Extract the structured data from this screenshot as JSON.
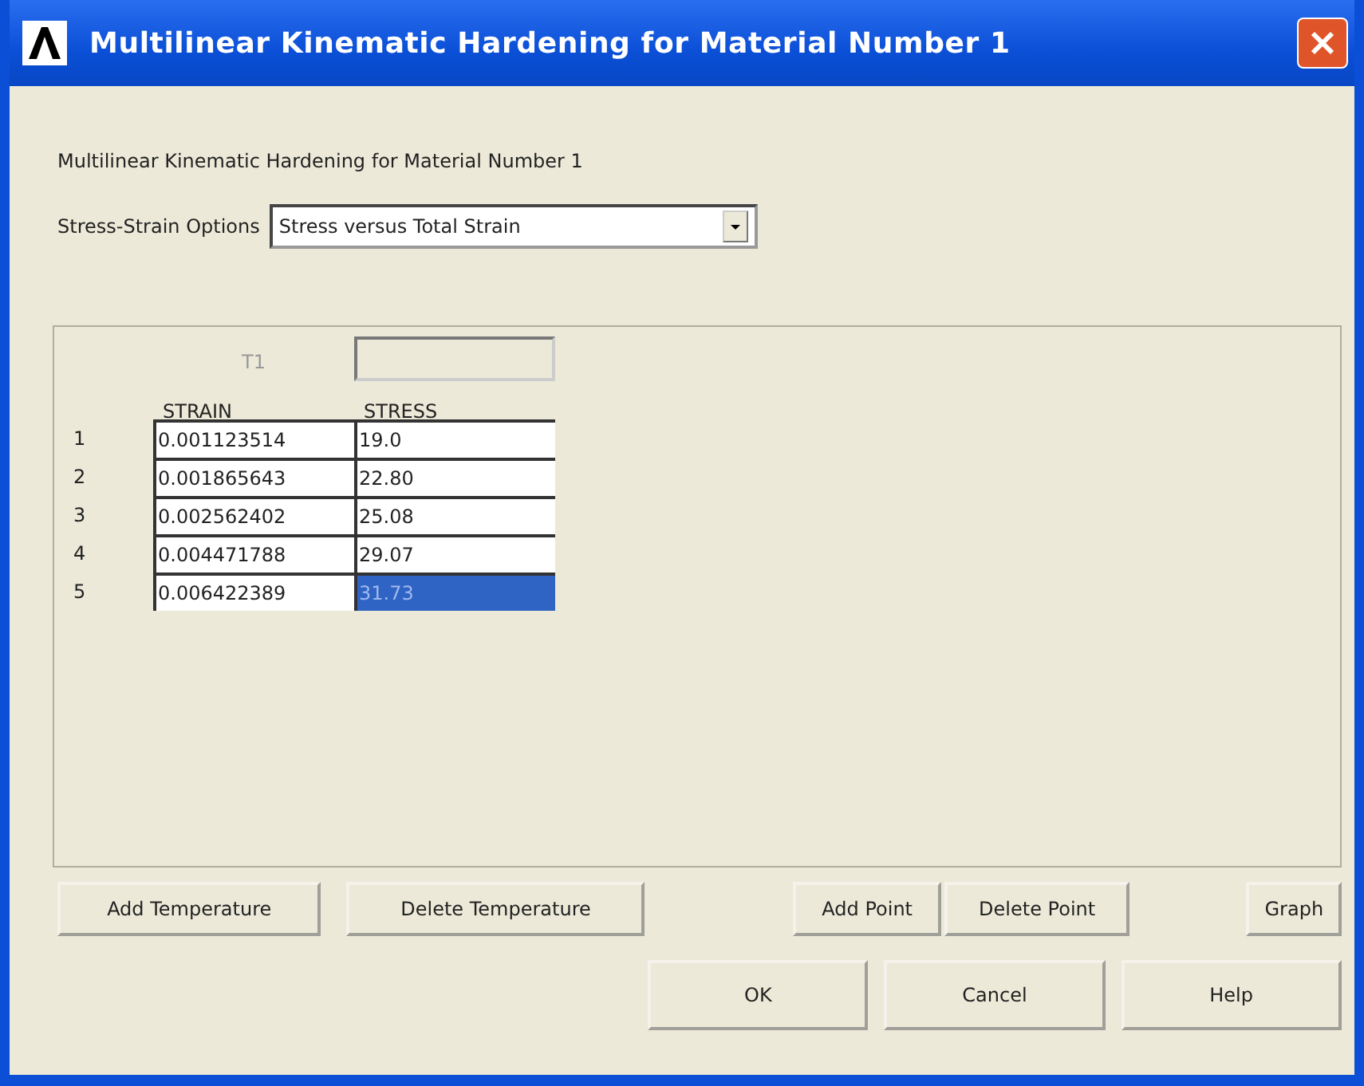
{
  "window": {
    "title": "Multilinear Kinematic Hardening for Material Number 1"
  },
  "heading": "Multilinear Kinematic Hardening for Material Number 1",
  "options": {
    "label": "Stress-Strain Options",
    "value": "Stress versus Total Strain"
  },
  "table": {
    "temperature_label": "T1",
    "columns": [
      "STRAIN",
      "STRESS"
    ],
    "rows": [
      {
        "number": "1",
        "strain": "0.001123514",
        "stress": "19.0",
        "selected": false
      },
      {
        "number": "2",
        "strain": "0.001865643",
        "stress": "22.80",
        "selected": false
      },
      {
        "number": "3",
        "strain": "0.002562402",
        "stress": "25.08",
        "selected": false
      },
      {
        "number": "4",
        "strain": "0.004471788",
        "stress": "29.07",
        "selected": false
      },
      {
        "number": "5",
        "strain": "0.006422389",
        "stress": "31.73",
        "selected": true
      }
    ]
  },
  "table_buttons": [
    "Add Temperature",
    "Delete Temperature",
    "Add Point",
    "Delete Point",
    "Graph"
  ],
  "dialog_buttons": [
    "OK",
    "Cancel",
    "Help"
  ]
}
